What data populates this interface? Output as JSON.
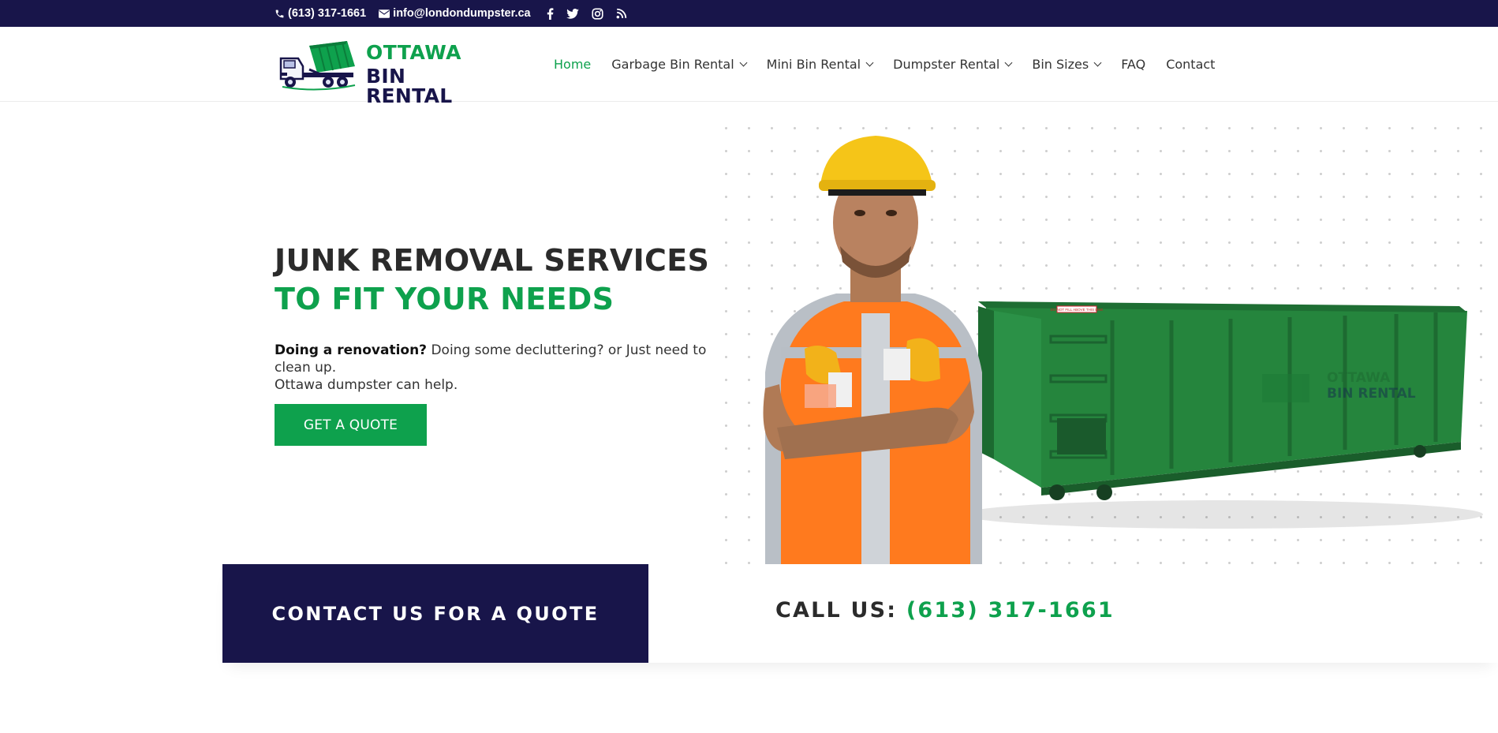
{
  "topbar": {
    "phone": "(613) 317-1661",
    "email": "info@londondumpster.ca",
    "socials": [
      "facebook-icon",
      "twitter-icon",
      "instagram-icon",
      "rss-icon"
    ]
  },
  "brand": {
    "line1": "OTTAWA",
    "line2": "BIN RENTAL",
    "colors": {
      "green": "#0ea14d",
      "navy": "#18154a"
    }
  },
  "nav": {
    "items": [
      {
        "label": "Home",
        "active": true
      },
      {
        "label": "Garbage Bin Rental",
        "dropdown": true
      },
      {
        "label": "Mini Bin Rental",
        "dropdown": true
      },
      {
        "label": "Dumpster Rental",
        "dropdown": true
      },
      {
        "label": "Bin Sizes",
        "dropdown": true
      },
      {
        "label": "FAQ"
      },
      {
        "label": "Contact"
      }
    ]
  },
  "hero": {
    "title_line1": "JUNK REMOVAL SERVICES",
    "title_line2": "TO FIT YOUR NEEDS",
    "intro_bold": "Doing a renovation?",
    "intro_rest": " Doing some decluttering? or Just need to clean up.",
    "intro_line2": "Ottawa dumpster can help.",
    "cta_label": "GET A QUOTE",
    "bin_sticker": "DO NOT FILL ABOVE THIS LINE",
    "bin_watermark_line1": "OTTAWA",
    "bin_watermark_line2": "BIN RENTAL"
  },
  "cta": {
    "contact_label": "CONTACT US FOR A QUOTE",
    "call_label": "CALL US: ",
    "call_number": "(613) 317-1661"
  }
}
